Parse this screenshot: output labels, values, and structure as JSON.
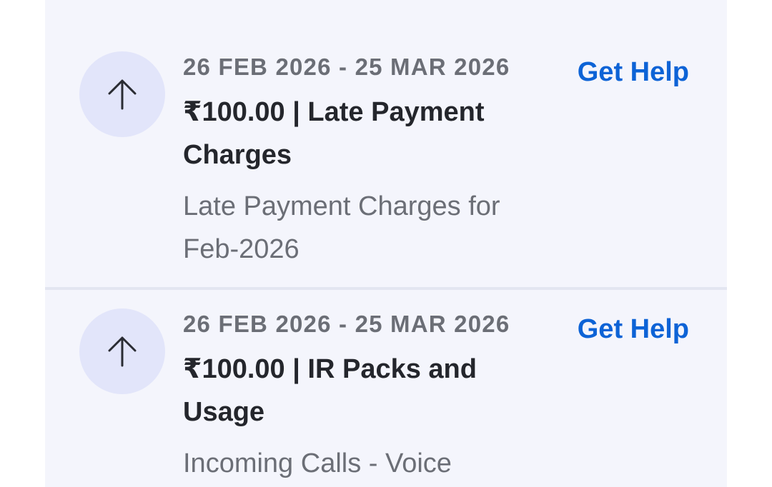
{
  "transactions": [
    {
      "date_range": "26 FEB 2026 - 25 MAR 2026",
      "title": "₹100.00 | Late Payment Charges",
      "description": "Late Payment Charges for Feb-2026",
      "action_label": "Get Help",
      "icon": "arrow-up-icon"
    },
    {
      "date_range": "26 FEB 2026 - 25 MAR 2026",
      "title": "₹100.00 | IR Packs and Usage",
      "description": "Incoming Calls - Voice",
      "action_label": "Get Help",
      "icon": "arrow-up-icon"
    }
  ],
  "colors": {
    "panel_background": "#f4f5fc",
    "icon_circle": "#e2e5fa",
    "link": "#0d63d6",
    "title_text": "#24262c",
    "secondary_text": "#6b6e76"
  }
}
